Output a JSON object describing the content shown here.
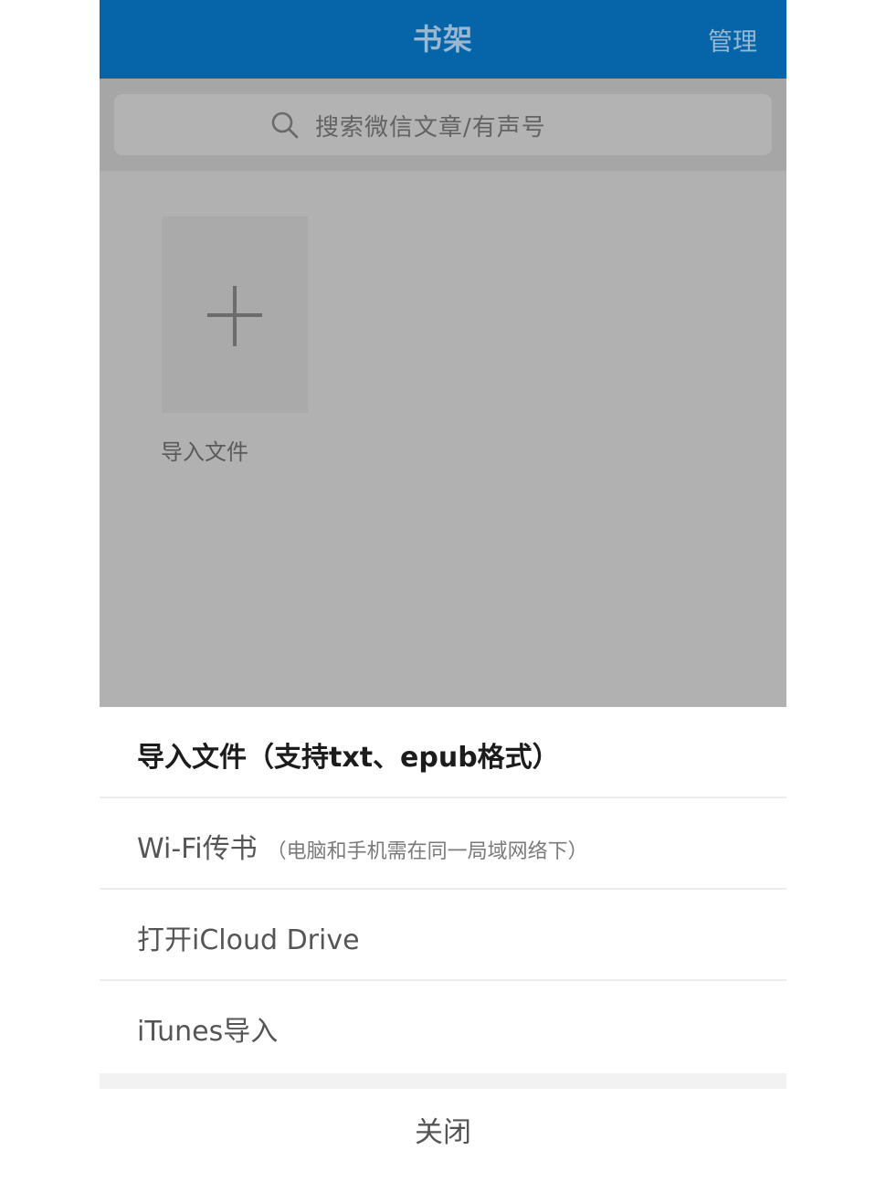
{
  "nav": {
    "title": "书架",
    "manage_label": "管理"
  },
  "search": {
    "icon": "search-icon",
    "placeholder": "搜索微信文章/有声号"
  },
  "shelf": {
    "add_tile_icon": "plus-icon",
    "add_label": "导入文件"
  },
  "sheet": {
    "items": [
      {
        "label": "导入文件（支持txt、epub格式）",
        "note": ""
      },
      {
        "label": "Wi-Fi传书",
        "note": "（电脑和手机需在同一局域网络下）"
      },
      {
        "label": "打开iCloud Drive",
        "note": ""
      },
      {
        "label": "iTunes导入",
        "note": ""
      }
    ],
    "close_label": "关闭"
  },
  "colors": {
    "nav_bg": "#0565a8",
    "overlay_dim": "#b1b1b1",
    "sheet_bg": "#ffffff"
  }
}
